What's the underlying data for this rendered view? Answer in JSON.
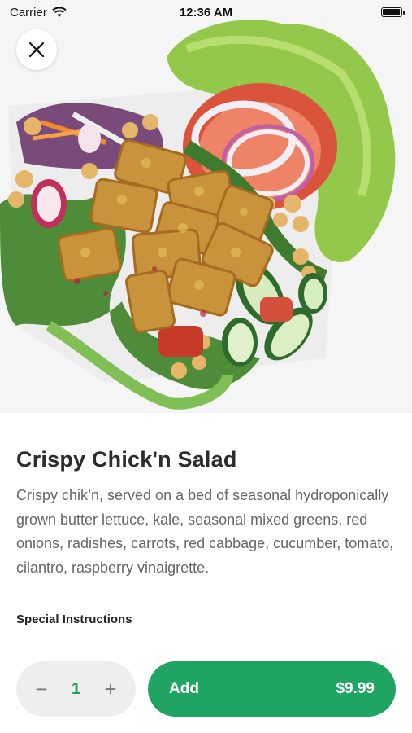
{
  "status_bar": {
    "carrier": "Carrier",
    "time": "12:36 AM",
    "battery_level": 0.95
  },
  "icons": {
    "close": "close-icon",
    "wifi": "wifi-icon",
    "battery": "battery-icon"
  },
  "item": {
    "title": "Crispy Chick'n Salad",
    "description": "Crispy chik’n, served on a bed of seasonal hydroponically grown butter lettuce, kale, seasonal mixed greens, red onions, radishes, carrots, red cabbage, cucumber, tomato, cilantro, raspberry vinaigrette.",
    "special_instructions_label": "Special Instructions"
  },
  "order": {
    "decrement": "−",
    "quantity": "1",
    "increment": "+",
    "add_label": "Add",
    "price": "$9.99"
  },
  "colors": {
    "accent": "#1fa463",
    "stepper_bg": "#eeeeee",
    "text_primary": "#2d2d2d",
    "text_secondary": "#666666"
  }
}
